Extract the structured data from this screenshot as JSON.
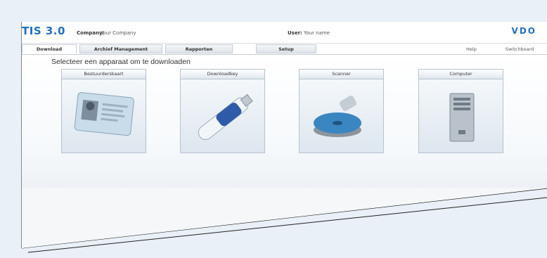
{
  "app": {
    "logo": "TIS 3.0",
    "brand": "VDO"
  },
  "header": {
    "company_label": "Company:",
    "company_value": "Your Company",
    "user_label": "User:",
    "user_value": "Your name"
  },
  "tabs": [
    {
      "label": "Download",
      "active": true
    },
    {
      "label": "Archief Management",
      "active": false
    },
    {
      "label": "Rapporten",
      "active": false
    },
    {
      "label": "Setup",
      "active": false
    }
  ],
  "toplinks": {
    "help": "Help",
    "switchboard": "Switchboard"
  },
  "main": {
    "prompt": "Selecteer een apparaat om te downloaden",
    "devices": [
      {
        "label": "Bestuurderskaart",
        "icon": "driver-card-icon"
      },
      {
        "label": "Downloadkey",
        "icon": "download-key-icon"
      },
      {
        "label": "Scanner",
        "icon": "scanner-icon"
      },
      {
        "label": "Computer",
        "icon": "computer-icon"
      }
    ]
  },
  "colors": {
    "accent": "#1f6fbf",
    "background": "#e9f0f7"
  }
}
